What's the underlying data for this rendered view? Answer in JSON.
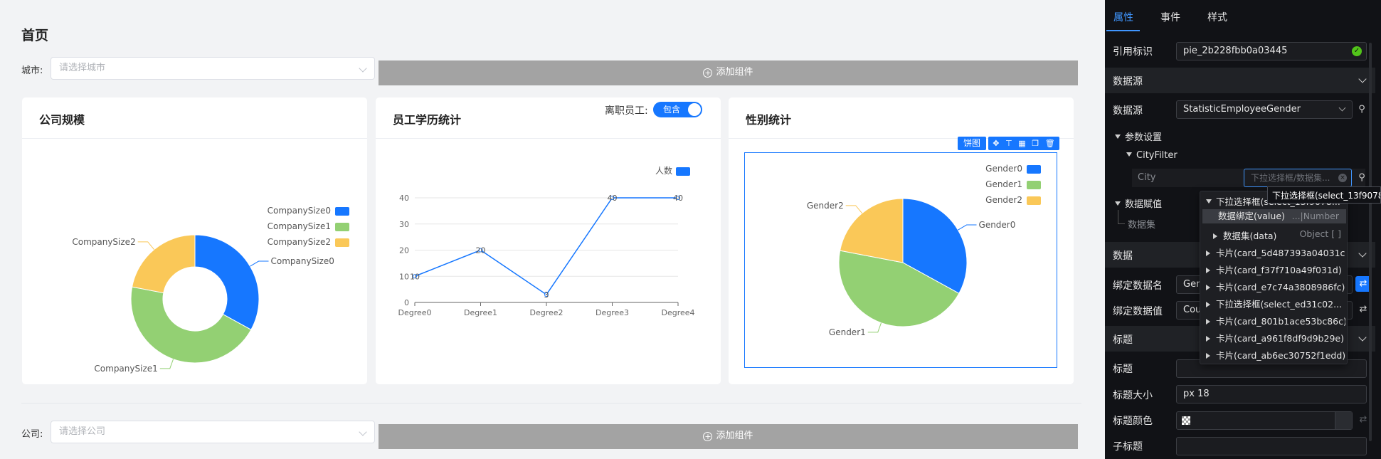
{
  "page": {
    "title": "首页",
    "city_filter": {
      "label": "城市:",
      "placeholder": "请选择城市"
    },
    "company_filter": {
      "label": "公司:",
      "placeholder": "请选择公司"
    },
    "add_component_label": "添加组件"
  },
  "cards": {
    "company_size": {
      "title": "公司规模",
      "chart_data": {
        "type": "pie",
        "variant": "donut",
        "categories": [
          "CompanySize0",
          "CompanySize1",
          "CompanySize2"
        ],
        "values": [
          33,
          45,
          22
        ],
        "colors": [
          "#1677ff",
          "#93d073",
          "#fac858"
        ],
        "legend": [
          "CompanySize0",
          "CompanySize1",
          "CompanySize2"
        ],
        "legend_position": "top-right"
      }
    },
    "education": {
      "title": "员工学历统计",
      "resigned_label": "离职员工:",
      "toggle_label": "包含",
      "chart_data": {
        "type": "line",
        "categories": [
          "Degree0",
          "Degree1",
          "Degree2",
          "Degree3",
          "Degree4"
        ],
        "series": [
          {
            "name": "人数",
            "values": [
              10,
              20,
              3,
              40,
              40
            ],
            "color": "#1677ff"
          }
        ],
        "ylim": [
          0,
          40
        ],
        "yticks": [
          0,
          10,
          20,
          30,
          40
        ],
        "grid": true,
        "legend_position": "top-right"
      }
    },
    "gender": {
      "title": "性别统计",
      "badge": "饼图",
      "chart_data": {
        "type": "pie",
        "categories": [
          "Gender0",
          "Gender1",
          "Gender2"
        ],
        "values": [
          33,
          45,
          22
        ],
        "colors": [
          "#1677ff",
          "#93d073",
          "#fac858"
        ],
        "legend": [
          "Gender0",
          "Gender1",
          "Gender2"
        ],
        "legend_position": "top-right"
      }
    }
  },
  "panel": {
    "tabs": [
      "属性",
      "事件",
      "样式"
    ],
    "active_tab": "属性",
    "ref_label": "引用标识",
    "ref_value": "pie_2b228fbb0a03445",
    "datasource_section": "数据源",
    "datasource_label": "数据源",
    "datasource_value": "StatisticEmployeeGender",
    "param_settings": "参数设置",
    "city_filter_node": "CityFilter",
    "city_param": "City",
    "city_input_placeholder": "下拉选择框/数据集...",
    "data_assign": "数据赋值",
    "dataset_label": "数据集",
    "data_section": "数据",
    "bind_name_label": "绑定数据名",
    "bind_name_value": "Gen",
    "bind_value_label": "绑定数据值",
    "bind_value_value": "Cou",
    "title_section": "标题",
    "title_label": "标题",
    "title_size_label": "标题大小",
    "title_size_value": "px  18",
    "title_color_label": "标题颜色",
    "subtitle_label": "子标题",
    "tooltip": "下拉选择框(select_13f9078",
    "dropdown": {
      "items": [
        {
          "label": "下拉选择框(select_13f9078...",
          "expanded": true
        },
        {
          "label": "数据绑定(value)",
          "hint": "...|Number",
          "selected": true
        },
        {
          "label": "数据集(data)",
          "hint": "Object [ ]"
        },
        {
          "label": "卡片(card_5d487393a04031c)"
        },
        {
          "label": "卡片(card_f37f710a49f031d)"
        },
        {
          "label": "卡片(card_e7c74a3808986fc)"
        },
        {
          "label": "下拉选择框(select_ed31c02..."
        },
        {
          "label": "卡片(card_801b1ace53bc86c)"
        },
        {
          "label": "卡片(card_a961f8df9d9b29e)"
        },
        {
          "label": "卡片(card_ab6ec30752f1edd)"
        }
      ]
    }
  }
}
